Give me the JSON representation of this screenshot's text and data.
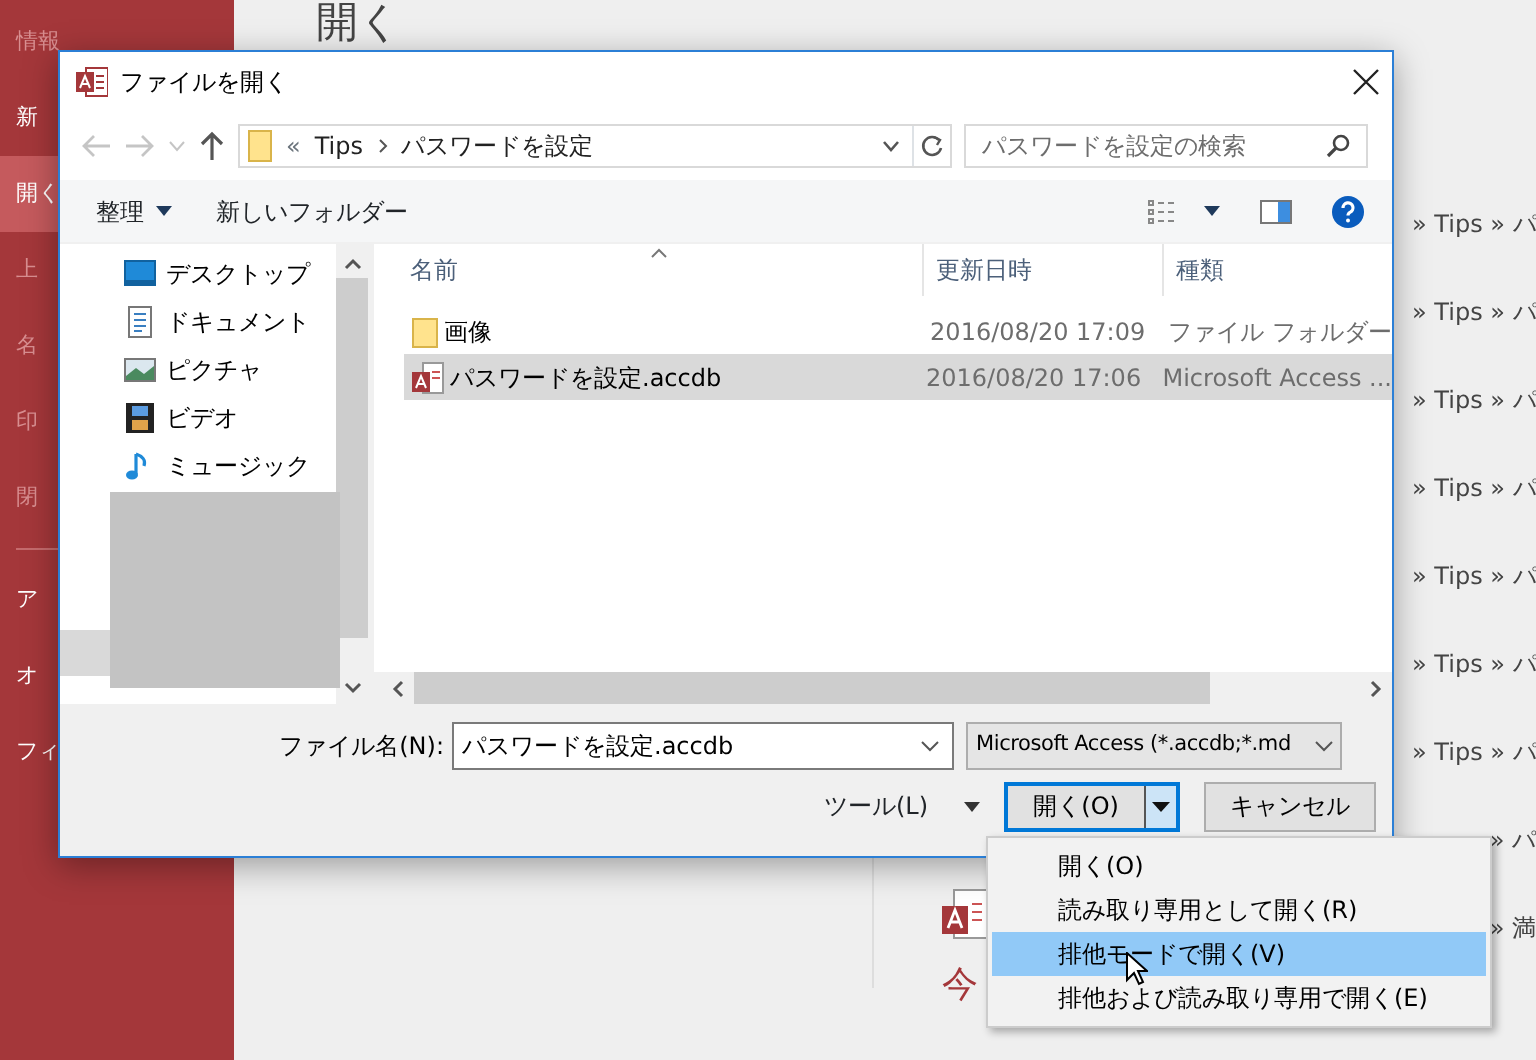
{
  "backstage": {
    "heading": "開く",
    "nav": [
      {
        "label": "情報",
        "selected": false,
        "disabled": true
      },
      {
        "label": "新",
        "selected": false,
        "disabled": false
      },
      {
        "label": "開く",
        "selected": true,
        "disabled": false
      },
      {
        "label": "上",
        "selected": false,
        "disabled": true
      },
      {
        "label": "名",
        "selected": false,
        "disabled": true
      },
      {
        "label": "印",
        "selected": false,
        "disabled": true
      },
      {
        "label": "閉",
        "selected": false,
        "disabled": true
      }
    ],
    "nav_bottom": [
      {
        "label": "ア",
        "selected": false,
        "disabled": false
      },
      {
        "label": "オ",
        "selected": false,
        "disabled": false
      },
      {
        "label": "フィ",
        "selected": false,
        "disabled": false
      }
    ],
    "paths": [
      "» Tips » パ",
      "» Tips » パ",
      "» Tips » パ",
      "» Tips » パ",
      "» Tips » パ",
      "» Tips » パ",
      "» Tips » パ",
      "» パ",
      "» 満"
    ],
    "recent_label": "今"
  },
  "dialog": {
    "title": "ファイルを開く",
    "address": {
      "overflow": "«",
      "segments": [
        "Tips",
        "パスワードを設定"
      ]
    },
    "search": {
      "placeholder": "パスワードを設定の検索"
    },
    "organize": "整理",
    "new_folder": "新しいフォルダー",
    "nav_pane": [
      {
        "label": "デスクトップ",
        "kind": "desktop"
      },
      {
        "label": "ドキュメント",
        "kind": "documents"
      },
      {
        "label": "ピクチャ",
        "kind": "pictures"
      },
      {
        "label": "ビデオ",
        "kind": "videos"
      },
      {
        "label": "ミュージック",
        "kind": "music"
      }
    ],
    "columns": [
      "名前",
      "更新日時",
      "種類"
    ],
    "files": [
      {
        "name": "画像",
        "modified": "2016/08/20 17:09",
        "type": "ファイル フォルダー",
        "kind": "folder",
        "selected": false
      },
      {
        "name": "パスワードを設定.accdb",
        "modified": "2016/08/20 17:06",
        "type": "Microsoft Access ...",
        "kind": "access",
        "selected": true
      }
    ],
    "file_name_label": "ファイル名(N):",
    "file_name": "パスワードを設定.accdb",
    "filter": "Microsoft Access (*.accdb;*.md",
    "tools": "ツール(L)",
    "open": "開く(O)",
    "cancel": "キャンセル"
  },
  "open_menu": {
    "items": [
      {
        "label": "開く(O)",
        "selected": false
      },
      {
        "label": "読み取り専用として開く(R)",
        "selected": false
      },
      {
        "label": "排他モードで開く(V)",
        "selected": true
      },
      {
        "label": "排他および読み取り専用で開く(E)",
        "selected": false
      }
    ]
  }
}
